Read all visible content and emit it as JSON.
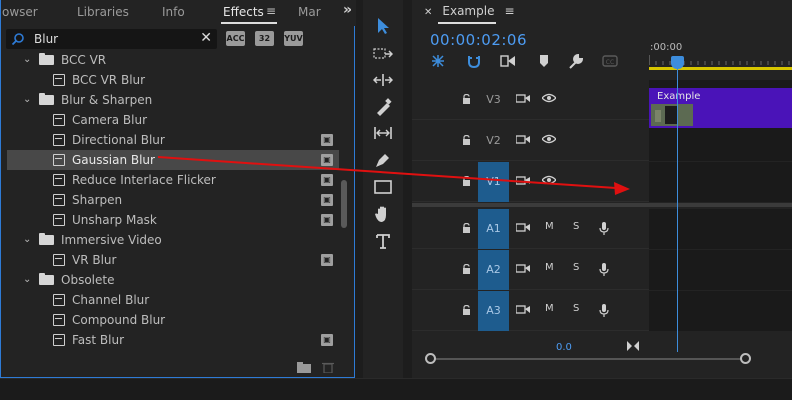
{
  "effects_panel": {
    "tabs": [
      {
        "label": "owser",
        "active": false
      },
      {
        "label": "Libraries",
        "active": false
      },
      {
        "label": "Info",
        "active": false
      },
      {
        "label": "Effects",
        "active": true
      },
      {
        "label": "Mar",
        "active": false
      }
    ],
    "menu_glyph": "≡",
    "overflow_glyph": "»",
    "search": {
      "value": "Blur",
      "placeholder": ""
    },
    "clear_glyph": "✕",
    "filter_buttons": [
      "ACC",
      "32",
      "YUV"
    ],
    "tree": [
      {
        "label": "BCC VR",
        "type": "folder",
        "level": 0
      },
      {
        "label": "BCC VR Blur",
        "type": "effect",
        "level": 1,
        "accelerated": false
      },
      {
        "label": "Blur & Sharpen",
        "type": "folder",
        "level": 0
      },
      {
        "label": "Camera Blur",
        "type": "effect",
        "level": 1,
        "accelerated": false
      },
      {
        "label": "Directional Blur",
        "type": "effect",
        "level": 1,
        "accelerated": true
      },
      {
        "label": "Gaussian Blur",
        "type": "effect",
        "level": 1,
        "accelerated": true,
        "selected": true
      },
      {
        "label": "Reduce Interlace Flicker",
        "type": "effect",
        "level": 1,
        "accelerated": true
      },
      {
        "label": "Sharpen",
        "type": "effect",
        "level": 1,
        "accelerated": true
      },
      {
        "label": "Unsharp Mask",
        "type": "effect",
        "level": 1,
        "accelerated": true
      },
      {
        "label": "Immersive Video",
        "type": "folder",
        "level": 0
      },
      {
        "label": "VR Blur",
        "type": "effect",
        "level": 1,
        "accelerated": true
      },
      {
        "label": "Obsolete",
        "type": "folder",
        "level": 0
      },
      {
        "label": "Channel Blur",
        "type": "effect",
        "level": 1,
        "accelerated": false
      },
      {
        "label": "Compound Blur",
        "type": "effect",
        "level": 1,
        "accelerated": false
      },
      {
        "label": "Fast Blur",
        "type": "effect",
        "level": 1,
        "accelerated": true
      }
    ]
  },
  "tools": [
    "selection-tool",
    "track-select-tool",
    "ripple-edit-tool",
    "razor-tool",
    "slip-tool",
    "pen-tool",
    "rectangle-tool",
    "hand-tool",
    "type-tool"
  ],
  "timeline": {
    "close_glyph": "✕",
    "sequence_name": "Example",
    "menu_glyph": "≡",
    "timecode": "00:00:02:06",
    "ruler_label": ":00:00",
    "video_tracks": [
      {
        "name": "V3",
        "source_target": false
      },
      {
        "name": "V2",
        "source_target": false
      },
      {
        "name": "V1",
        "source_target": true
      }
    ],
    "audio_tracks": [
      {
        "name": "A1",
        "m": "M",
        "s": "S"
      },
      {
        "name": "A2",
        "m": "M",
        "s": "S"
      },
      {
        "name": "A3",
        "m": "M",
        "s": "S"
      }
    ],
    "clip": {
      "name": "Example",
      "color": "#4a13b8"
    },
    "zoom_value": "0.0"
  },
  "colors": {
    "accent": "#2e7bd6",
    "timecode": "#4d9cf3",
    "arrow": "#e01010",
    "clip": "#4a13b8",
    "work_area": "#d7c600"
  }
}
